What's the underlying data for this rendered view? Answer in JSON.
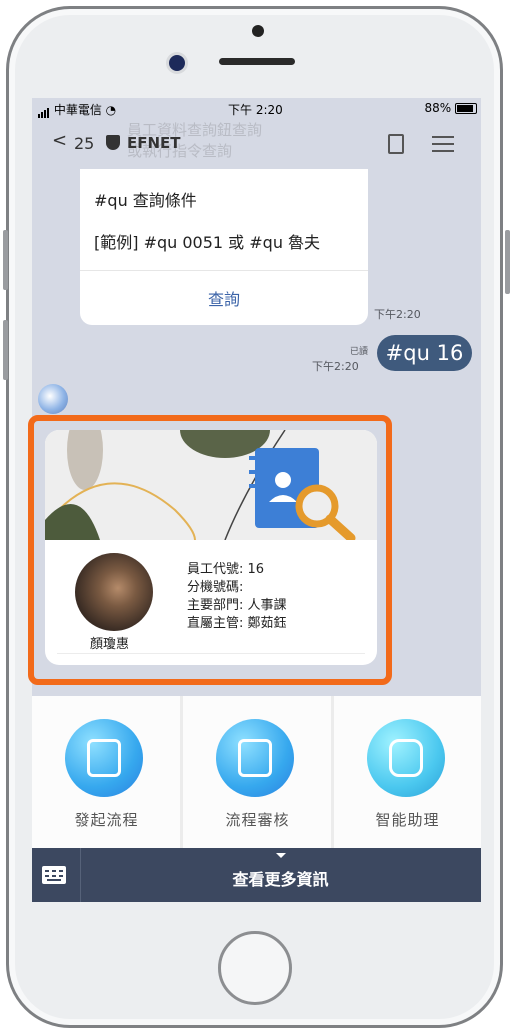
{
  "status_bar": {
    "carrier": "中華電信",
    "time": "下午 2:20",
    "battery": "88%"
  },
  "header": {
    "unread_count": "25",
    "chat_name": "EFNET",
    "ghost_text": "員工資料查詢鈕查詢\n或執行指令查詢"
  },
  "query_card": {
    "line1": "#qu 查詢條件",
    "line2": "[範例] #qu 0051 或 #qu 魯夫",
    "action": "查詢",
    "timestamp": "下午2:20"
  },
  "sent_message": {
    "text": "#qu 16",
    "read_label": "已讀",
    "timestamp": "下午2:20"
  },
  "employee_card": {
    "name": "顏瓊惠",
    "employee_id": "員工代號: 16",
    "extension": "分機號碼:",
    "department": "主要部門: 人事課",
    "supervisor": "直屬主管: 鄭茹鈺"
  },
  "rich_menu": {
    "items": [
      {
        "label": "發起流程",
        "icon": "document-edit-icon"
      },
      {
        "label": "流程審核",
        "icon": "document-stamp-icon"
      },
      {
        "label": "智能助理",
        "icon": "robot-icon"
      }
    ],
    "more_info": "查看更多資訊"
  },
  "colors": {
    "highlight": "#f26a1a",
    "bubble": "#3f5a7d",
    "bottom_bar": "#3c4860",
    "accent_link": "#3b63a8"
  }
}
